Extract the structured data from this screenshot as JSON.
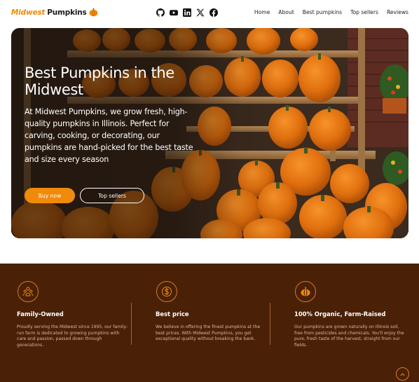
{
  "brand": {
    "part1": "Midwest",
    "part2": "Pumpkins",
    "logo_icon": "pumpkin-logo-icon",
    "accent": "#f08a0b"
  },
  "social": [
    {
      "name": "github-icon"
    },
    {
      "name": "youtube-icon"
    },
    {
      "name": "linkedin-icon"
    },
    {
      "name": "x-icon"
    },
    {
      "name": "facebook-icon"
    }
  ],
  "nav": {
    "home": "Home",
    "about": "About",
    "best": "Best pumpkins",
    "sellers": "Top sellers",
    "reviews": "Reviews"
  },
  "hero": {
    "title": "Best Pumpkins in the Midwest",
    "text": "At Midwest Pumpkins, we grow fresh, high-quality pumpkins in Illinois. Perfect for carving, cooking, or decorating, our pumpkins are hand-picked for the best taste and size every season",
    "buy_label": "Buy now",
    "sellers_label": "Top sellers"
  },
  "features": [
    {
      "icon": "family-icon",
      "title": "Family-Owned",
      "desc": "Proudly serving the Midwest since 1995, our family-run farm is dedicated to growing pumpkins with care and passion, passed down through generations."
    },
    {
      "icon": "dollar-icon",
      "title": "Best price",
      "desc": "We believe in offering the finest pumpkins at the best prices. With Midwest Pumpkins, you get exceptional quality without breaking the bank."
    },
    {
      "icon": "pumpkin-icon",
      "title": "100% Organic, Farm-Raised",
      "desc": "Our pumpkins are grown naturally on Illinois soil, free from pesticides and chemicals. You'll enjoy the pure, fresh taste of the harvest, straight from our fields."
    }
  ],
  "colors": {
    "footer_bg": "#4a2107",
    "accent": "#f08a0b"
  },
  "scroll_top_icon": "chevron-up-icon"
}
